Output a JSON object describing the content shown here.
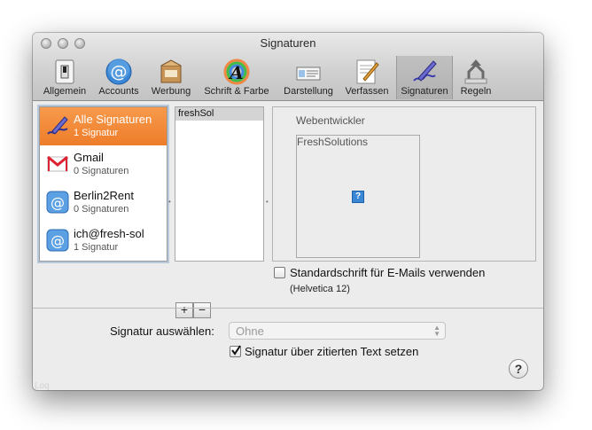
{
  "window": {
    "title": "Signaturen"
  },
  "toolbar": {
    "items": [
      {
        "label": "Allgemein",
        "icon": "switch-icon"
      },
      {
        "label": "Accounts",
        "icon": "at-icon"
      },
      {
        "label": "Werbung",
        "icon": "junk-mail-icon"
      },
      {
        "label": "Schrift & Farbe",
        "icon": "font-color-icon"
      },
      {
        "label": "Darstellung",
        "icon": "viewing-icon"
      },
      {
        "label": "Verfassen",
        "icon": "compose-icon"
      },
      {
        "label": "Signaturen",
        "icon": "signature-icon",
        "selected": true
      },
      {
        "label": "Regeln",
        "icon": "rules-icon"
      }
    ]
  },
  "accounts": [
    {
      "name": "Alle Signaturen",
      "count": "1 Signatur",
      "icon": "signature-icon",
      "selected": true
    },
    {
      "name": "Gmail",
      "count": "0 Signaturen",
      "icon": "gmail-icon"
    },
    {
      "name": "Berlin2Rent",
      "count": "0 Signaturen",
      "icon": "at-icon"
    },
    {
      "name": "ich@fresh-sol",
      "count": "1 Signatur",
      "icon": "at-icon"
    }
  ],
  "signatures": [
    {
      "name": "freshSol"
    }
  ],
  "editor": {
    "text": "Webentwickler",
    "box_text": "FreshSolutions",
    "missing_image": "?"
  },
  "buttons": {
    "add": "+",
    "remove": "−"
  },
  "default_font": {
    "label": "Standardschrift für E-Mails verwenden",
    "checked": false,
    "font": "(Helvetica 12)"
  },
  "bottom": {
    "choose_label": "Signatur auswählen:",
    "choose_value": "Ohne",
    "place_above_label": "Signatur über zitierten Text setzen",
    "place_above_checked": true,
    "help": "?"
  },
  "watermark": "Loq",
  "colors": {
    "selection_orange": "#ef812f",
    "accent_blue": "#3a87d6"
  }
}
